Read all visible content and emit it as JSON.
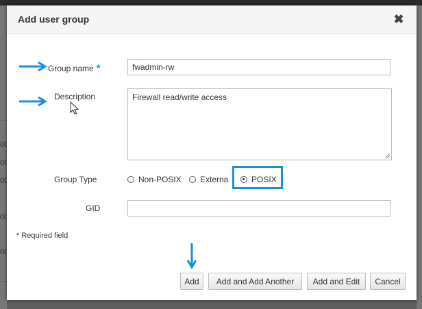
{
  "dialog": {
    "title": "Add user group",
    "close_glyph": "✖"
  },
  "form": {
    "group_name": {
      "label": "Group name",
      "required_mark": "*",
      "value": "fwadmin-rw"
    },
    "description": {
      "label": "Description",
      "value": "Firewall read/write access"
    },
    "group_type": {
      "label": "Group Type",
      "options": [
        "Non-POSIX",
        "External",
        "POSIX"
      ],
      "visible_text": [
        "Non-POSIX",
        "Externa",
        "POSIX"
      ],
      "selected": "POSIX"
    },
    "gid": {
      "label": "GID",
      "value": ""
    },
    "required_note": "* Required field"
  },
  "buttons": {
    "add": "Add",
    "add_another": "Add and Add Another",
    "add_edit": "Add and Edit",
    "cancel": "Cancel"
  },
  "background_fragments": [
    "00",
    "00",
    "00",
    "00",
    "00",
    "00"
  ],
  "colors": {
    "accent": "#1a8fd8",
    "overlay": "#5f5f5f",
    "header_bg": "#f5f5f5"
  },
  "icons": {
    "close": "close-icon",
    "annotation_arrow": "arrow-icon",
    "mouse_cursor": "mouse-cursor-icon"
  }
}
